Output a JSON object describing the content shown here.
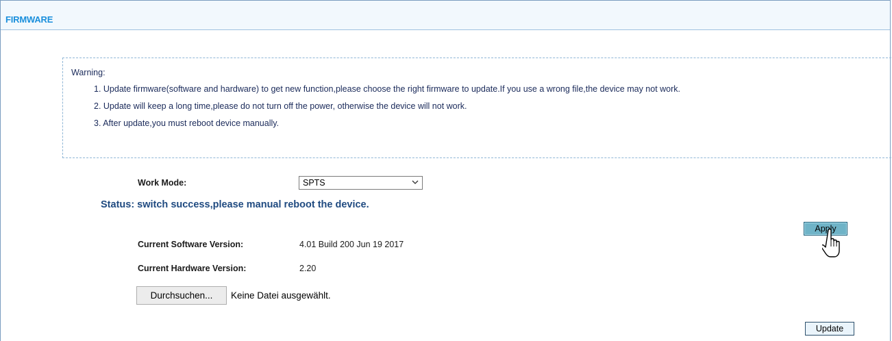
{
  "header": {
    "title": "FIRMWARE"
  },
  "warning": {
    "title": "Warning:",
    "lines": [
      "1. Update firmware(software and hardware) to get new function,please choose the right firmware to update.If you use a wrong file,the device may not work.",
      "2. Update will keep a long time,please do not turn off the power, otherwise the device will not work.",
      "3. After update,you must reboot device manually."
    ]
  },
  "work_mode": {
    "label": "Work Mode:",
    "selected": "SPTS"
  },
  "status": {
    "text": "Status: switch success,please manual reboot the device."
  },
  "apply_label": "Apply",
  "versions": {
    "software_label": "Current Software Version:",
    "software_value": "4.01 Build 200 Jun 19 2017",
    "hardware_label": "Current Hardware Version:",
    "hardware_value": "2.20"
  },
  "file": {
    "browse_label": "Durchsuchen...",
    "status": "Keine Datei ausgewählt."
  },
  "update_label": "Update",
  "colors": {
    "header_text": "#1a8fdc",
    "status_text": "#1f4a80",
    "apply_bg": "#6fb3c7"
  },
  "icons": {
    "dropdown": "chevron-down-icon",
    "pointer": "hand-cursor-icon"
  }
}
